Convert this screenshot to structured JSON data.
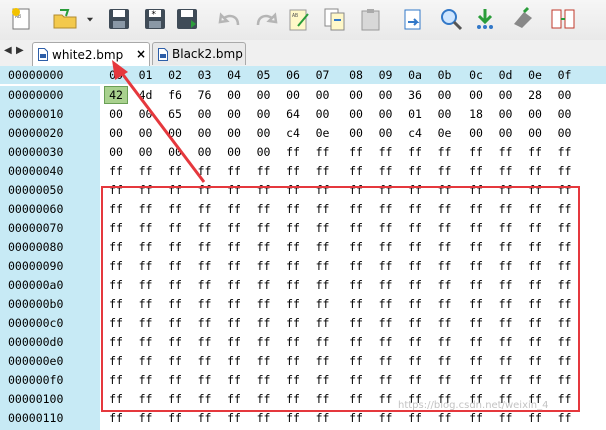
{
  "toolbar": {
    "buttons": [
      {
        "name": "new-file-icon"
      },
      {
        "name": "open-file-icon"
      },
      {
        "name": "dropdown-arrow-icon"
      },
      {
        "name": "save-icon"
      },
      {
        "name": "save-as-icon"
      },
      {
        "name": "save-all-icon"
      },
      {
        "name": "undo-icon"
      },
      {
        "name": "redo-icon"
      },
      {
        "name": "edit-icon"
      },
      {
        "name": "copy-icon"
      },
      {
        "name": "paste-icon"
      },
      {
        "name": "export-icon"
      },
      {
        "name": "find-icon"
      },
      {
        "name": "download-icon"
      },
      {
        "name": "bookmark-icon"
      },
      {
        "name": "compare-icon"
      }
    ]
  },
  "tabs": [
    {
      "label": "white2.bmp",
      "active": true,
      "close": "×"
    },
    {
      "label": "Black2.bmp",
      "active": false
    }
  ],
  "nav": {
    "back": "◀",
    "forward": "▶"
  },
  "hex": {
    "header_offset": "00000000",
    "columns": [
      "00",
      "01",
      "02",
      "03",
      "04",
      "05",
      "06",
      "07",
      "08",
      "09",
      "0a",
      "0b",
      "0c",
      "0d",
      "0e",
      "0f"
    ],
    "rows": [
      {
        "offset": "00000000",
        "bytes": [
          "42",
          "4d",
          "f6",
          "76",
          "00",
          "00",
          "00",
          "00",
          "00",
          "00",
          "36",
          "00",
          "00",
          "00",
          "28",
          "00"
        ]
      },
      {
        "offset": "00000010",
        "bytes": [
          "00",
          "00",
          "65",
          "00",
          "00",
          "00",
          "64",
          "00",
          "00",
          "00",
          "01",
          "00",
          "18",
          "00",
          "00",
          "00"
        ]
      },
      {
        "offset": "00000020",
        "bytes": [
          "00",
          "00",
          "00",
          "00",
          "00",
          "00",
          "c4",
          "0e",
          "00",
          "00",
          "c4",
          "0e",
          "00",
          "00",
          "00",
          "00"
        ]
      },
      {
        "offset": "00000030",
        "bytes": [
          "00",
          "00",
          "00",
          "00",
          "00",
          "00",
          "ff",
          "ff",
          "ff",
          "ff",
          "ff",
          "ff",
          "ff",
          "ff",
          "ff",
          "ff"
        ]
      },
      {
        "offset": "00000040",
        "bytes": [
          "ff",
          "ff",
          "ff",
          "ff",
          "ff",
          "ff",
          "ff",
          "ff",
          "ff",
          "ff",
          "ff",
          "ff",
          "ff",
          "ff",
          "ff",
          "ff"
        ]
      },
      {
        "offset": "00000050",
        "bytes": [
          "ff",
          "ff",
          "ff",
          "ff",
          "ff",
          "ff",
          "ff",
          "ff",
          "ff",
          "ff",
          "ff",
          "ff",
          "ff",
          "ff",
          "ff",
          "ff"
        ]
      },
      {
        "offset": "00000060",
        "bytes": [
          "ff",
          "ff",
          "ff",
          "ff",
          "ff",
          "ff",
          "ff",
          "ff",
          "ff",
          "ff",
          "ff",
          "ff",
          "ff",
          "ff",
          "ff",
          "ff"
        ]
      },
      {
        "offset": "00000070",
        "bytes": [
          "ff",
          "ff",
          "ff",
          "ff",
          "ff",
          "ff",
          "ff",
          "ff",
          "ff",
          "ff",
          "ff",
          "ff",
          "ff",
          "ff",
          "ff",
          "ff"
        ]
      },
      {
        "offset": "00000080",
        "bytes": [
          "ff",
          "ff",
          "ff",
          "ff",
          "ff",
          "ff",
          "ff",
          "ff",
          "ff",
          "ff",
          "ff",
          "ff",
          "ff",
          "ff",
          "ff",
          "ff"
        ]
      },
      {
        "offset": "00000090",
        "bytes": [
          "ff",
          "ff",
          "ff",
          "ff",
          "ff",
          "ff",
          "ff",
          "ff",
          "ff",
          "ff",
          "ff",
          "ff",
          "ff",
          "ff",
          "ff",
          "ff"
        ]
      },
      {
        "offset": "000000a0",
        "bytes": [
          "ff",
          "ff",
          "ff",
          "ff",
          "ff",
          "ff",
          "ff",
          "ff",
          "ff",
          "ff",
          "ff",
          "ff",
          "ff",
          "ff",
          "ff",
          "ff"
        ]
      },
      {
        "offset": "000000b0",
        "bytes": [
          "ff",
          "ff",
          "ff",
          "ff",
          "ff",
          "ff",
          "ff",
          "ff",
          "ff",
          "ff",
          "ff",
          "ff",
          "ff",
          "ff",
          "ff",
          "ff"
        ]
      },
      {
        "offset": "000000c0",
        "bytes": [
          "ff",
          "ff",
          "ff",
          "ff",
          "ff",
          "ff",
          "ff",
          "ff",
          "ff",
          "ff",
          "ff",
          "ff",
          "ff",
          "ff",
          "ff",
          "ff"
        ]
      },
      {
        "offset": "000000d0",
        "bytes": [
          "ff",
          "ff",
          "ff",
          "ff",
          "ff",
          "ff",
          "ff",
          "ff",
          "ff",
          "ff",
          "ff",
          "ff",
          "ff",
          "ff",
          "ff",
          "ff"
        ]
      },
      {
        "offset": "000000e0",
        "bytes": [
          "ff",
          "ff",
          "ff",
          "ff",
          "ff",
          "ff",
          "ff",
          "ff",
          "ff",
          "ff",
          "ff",
          "ff",
          "ff",
          "ff",
          "ff",
          "ff"
        ]
      },
      {
        "offset": "000000f0",
        "bytes": [
          "ff",
          "ff",
          "ff",
          "ff",
          "ff",
          "ff",
          "ff",
          "ff",
          "ff",
          "ff",
          "ff",
          "ff",
          "ff",
          "ff",
          "ff",
          "ff"
        ]
      },
      {
        "offset": "00000100",
        "bytes": [
          "ff",
          "ff",
          "ff",
          "ff",
          "ff",
          "ff",
          "ff",
          "ff",
          "ff",
          "ff",
          "ff",
          "ff",
          "ff",
          "ff",
          "ff",
          "ff"
        ]
      },
      {
        "offset": "00000110",
        "bytes": [
          "ff",
          "ff",
          "ff",
          "ff",
          "ff",
          "ff",
          "ff",
          "ff",
          "ff",
          "ff",
          "ff",
          "ff",
          "ff",
          "ff",
          "ff",
          "ff"
        ]
      }
    ],
    "selected": {
      "row": 0,
      "col": 0
    }
  },
  "colors": {
    "offset_bg": "#c7eaf5",
    "selection": "#a9d18e",
    "annotation_red": "#e5383d"
  },
  "watermark": "https://blog.csdn.net/weixin_4"
}
